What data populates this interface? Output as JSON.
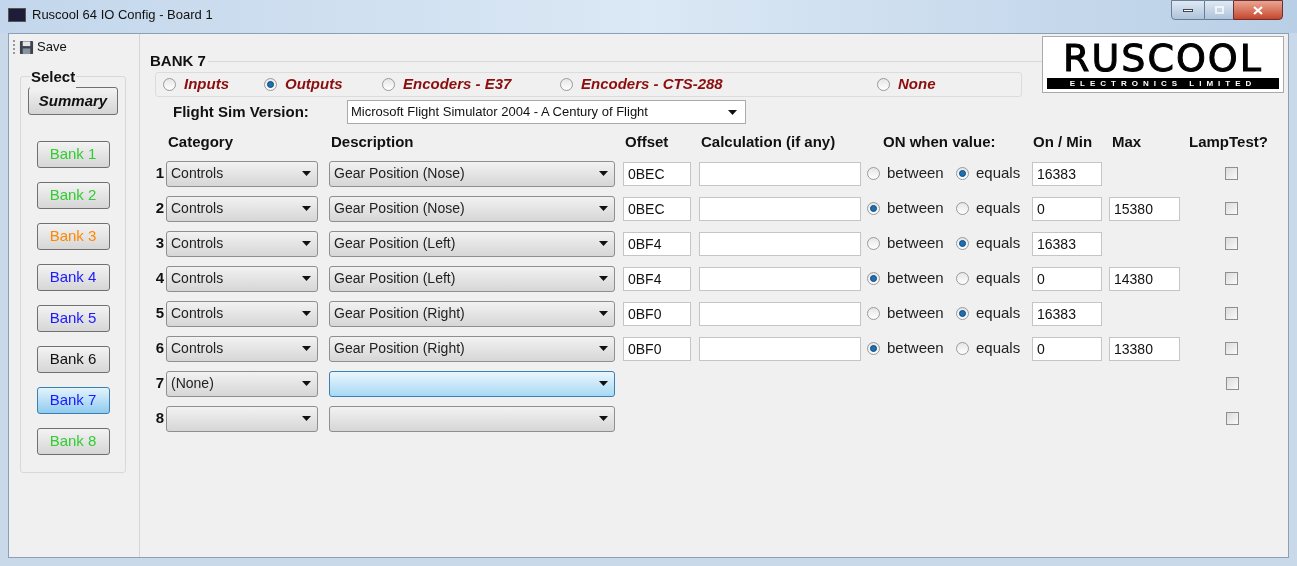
{
  "window": {
    "title": "Ruscool 64 IO Config - Board 1"
  },
  "toolbar": {
    "save": "Save"
  },
  "select_panel": {
    "title": "Select",
    "summary": "Summary",
    "banks": [
      {
        "label": "Bank 1",
        "color": "#33cc33",
        "selected": false
      },
      {
        "label": "Bank 2",
        "color": "#33cc33",
        "selected": false
      },
      {
        "label": "Bank 3",
        "color": "#ff8800",
        "selected": false
      },
      {
        "label": "Bank 4",
        "color": "#1a1aff",
        "selected": false
      },
      {
        "label": "Bank 5",
        "color": "#1a1aff",
        "selected": false
      },
      {
        "label": "Bank 6",
        "color": "#111111",
        "selected": false
      },
      {
        "label": "Bank 7",
        "color": "#1a1aff",
        "selected": true
      },
      {
        "label": "Bank 8",
        "color": "#33cc33",
        "selected": false
      }
    ]
  },
  "logo": {
    "name": "RUSCOOL",
    "tagline": "ELECTRONICS LIMITED"
  },
  "bank": {
    "title": "BANK 7",
    "modes": [
      {
        "label": "Inputs",
        "selected": false
      },
      {
        "label": "Outputs",
        "selected": true
      },
      {
        "label": "Encoders - E37",
        "selected": false
      },
      {
        "label": "Encoders - CTS-288",
        "selected": false
      },
      {
        "label": "None",
        "selected": false
      }
    ],
    "flight_sim": {
      "label": "Flight Sim Version:",
      "value": "Microsoft Flight Simulator 2004 - A Century of Flight"
    },
    "columns": [
      "Category",
      "Description",
      "Offset",
      "Calculation (if any)",
      "ON when value:",
      "On / Min",
      "Max",
      "LampTest?"
    ],
    "rows": [
      {
        "number": "1",
        "category": "Controls",
        "description": "Gear Position (Nose)",
        "offset": "0BEC",
        "conditions": [
          {
            "label": "between",
            "selected": false
          },
          {
            "label": "equals",
            "selected": true
          }
        ],
        "on_min": "16383",
        "lamp_test": false
      },
      {
        "number": "2",
        "category": "Controls",
        "description": "Gear Position (Nose)",
        "offset": "0BEC",
        "conditions": [
          {
            "label": "between",
            "selected": true
          },
          {
            "label": "equals",
            "selected": false
          }
        ],
        "on_min": "0",
        "max": "15380",
        "lamp_test": false
      },
      {
        "number": "3",
        "category": "Controls",
        "description": "Gear Position (Left)",
        "offset": "0BF4",
        "conditions": [
          {
            "label": "between",
            "selected": false
          },
          {
            "label": "equals",
            "selected": true
          }
        ],
        "on_min": "16383",
        "lamp_test": false
      },
      {
        "number": "4",
        "category": "Controls",
        "description": "Gear Position (Left)",
        "offset": "0BF4",
        "conditions": [
          {
            "label": "between",
            "selected": true
          },
          {
            "label": "equals",
            "selected": false
          }
        ],
        "on_min": "0",
        "max": "14380",
        "lamp_test": false
      },
      {
        "number": "5",
        "category": "Controls",
        "description": "Gear Position (Right)",
        "offset": "0BF0",
        "conditions": [
          {
            "label": "between",
            "selected": false
          },
          {
            "label": "equals",
            "selected": true
          }
        ],
        "on_min": "16383",
        "lamp_test": false
      },
      {
        "number": "6",
        "category": "Controls",
        "description": "Gear Position (Right)",
        "offset": "0BF0",
        "conditions": [
          {
            "label": "between",
            "selected": true
          },
          {
            "label": "equals",
            "selected": false
          }
        ],
        "on_min": "0",
        "max": "13380",
        "lamp_test": false
      },
      {
        "number": "7",
        "category": "(None)",
        "description_focused": true,
        "lamp_test": false
      },
      {
        "number": "8",
        "description_focused": false,
        "lamp_test": false
      }
    ]
  }
}
